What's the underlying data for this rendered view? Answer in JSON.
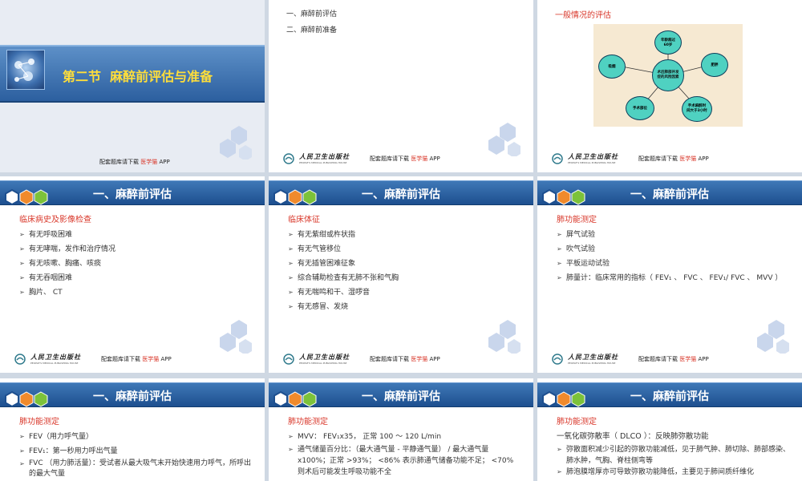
{
  "footer": {
    "publisher_cn": "人民卫生出版社",
    "publisher_en": "PEOPLE'S MEDICAL PUBLISHING HOUSE",
    "app_prefix": "配套题库请下载",
    "app_brand": "医学猫",
    "app_suffix": "APP"
  },
  "colors": {
    "bar": "#2a5f9e",
    "heading": "#d9382b",
    "hex_blue": "#1d4f8f",
    "hex_green": "#7cc23a",
    "hex_orange": "#f08a2c"
  },
  "slide1": {
    "title": "第二节  麻醉前评估与准备"
  },
  "slide2": {
    "items": [
      "一、麻醉前评估",
      "二、麻醉前准备"
    ]
  },
  "slide3": {
    "title": "一般情况的评估",
    "center": "术后肺部并发症的风险因素",
    "nodes": [
      "年龄超过60岁",
      "肥胖",
      "手术麻醉时间大于3小时",
      "手术部位",
      "吸烟"
    ]
  },
  "section_title": "一、麻醉前评估",
  "slide4": {
    "heading": "临床病史及影像检查",
    "bullets": [
      "有无呼吸困难",
      "有无哮喘，发作和治疗情况",
      "有无咳嗽、胸痛、咳痰",
      "有无吞咽困难",
      "胸片、 CT"
    ]
  },
  "slide5": {
    "heading": "临床体征",
    "bullets": [
      "有无紫绀或杵状指",
      "有无气管移位",
      "有无插管困难征象",
      "综合辅助检查有无肺不张和气胸",
      "有无喘鸣和干、湿啰音",
      "有无感冒、发烧"
    ]
  },
  "slide6": {
    "heading": "肺功能测定",
    "bullets": [
      "屏气试验",
      "吹气试验",
      "平板运动试验",
      "肺量计：临床常用的指标（ FEV₁ 、 FVC 、 FEV₁/ FVC 、 MVV ）"
    ]
  },
  "slide7": {
    "heading": "肺功能测定",
    "bullets": [
      "FEV（用力呼气量）",
      "FEV₁：第一秒用力呼出气量",
      "FVC （用力肺活量）：受试者从最大吸气末开始快速用力呼气，所呼出的最大气量"
    ]
  },
  "slide8": {
    "heading": "肺功能测定",
    "bullets": [
      "MVV： FEV₁x35， 正常 100 ～ 120 L/min",
      "通气储量百分比：（最大通气量 - 平静通气量） / 最大通气量 x100%；正常 >93%； <86% 表示肺通气储备功能不足； <70% 则术后可能发生呼吸功能不全"
    ]
  },
  "slide9": {
    "heading": "肺功能测定",
    "subheading": "一氧化碳弥散率（  DLCO  ）：反映肺弥散功能",
    "bullets": [
      "弥散面积减少引起的弥散功能减低，见于肺气肿、肺切除、肺部感染、肺水肿，气胸、脊柱侧弯等",
      "肺泡膜增厚亦可导致弥散功能降低，主要见于肺间质纤维化"
    ]
  }
}
